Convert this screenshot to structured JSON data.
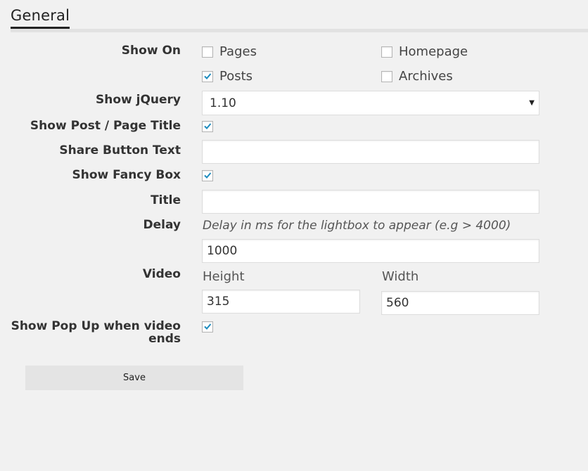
{
  "section": {
    "title": "General"
  },
  "show_on": {
    "label": "Show On",
    "options": [
      {
        "label": "Pages",
        "checked": false
      },
      {
        "label": "Homepage",
        "checked": false
      },
      {
        "label": "Posts",
        "checked": true
      },
      {
        "label": "Archives",
        "checked": false
      }
    ]
  },
  "show_jquery": {
    "label": "Show jQuery",
    "value": "1.10"
  },
  "show_title": {
    "label": "Show Post / Page Title",
    "checked": true
  },
  "share_button_text": {
    "label": "Share Button Text",
    "value": ""
  },
  "show_fancy_box": {
    "label": "Show Fancy Box",
    "checked": true
  },
  "title": {
    "label": "Title",
    "value": ""
  },
  "delay": {
    "label": "Delay",
    "hint": "Delay in ms for the lightbox to appear (e.g > 4000)",
    "value": "1000"
  },
  "video": {
    "label": "Video",
    "height_label": "Height",
    "height_value": "315",
    "width_label": "Width",
    "width_value": "560"
  },
  "show_popup": {
    "label_line1": "Show Pop Up when video",
    "label_line2": "ends",
    "checked": true
  },
  "save": {
    "label": "Save"
  },
  "colors": {
    "check": "#1e8cbe",
    "background": "#f1f1f1"
  }
}
